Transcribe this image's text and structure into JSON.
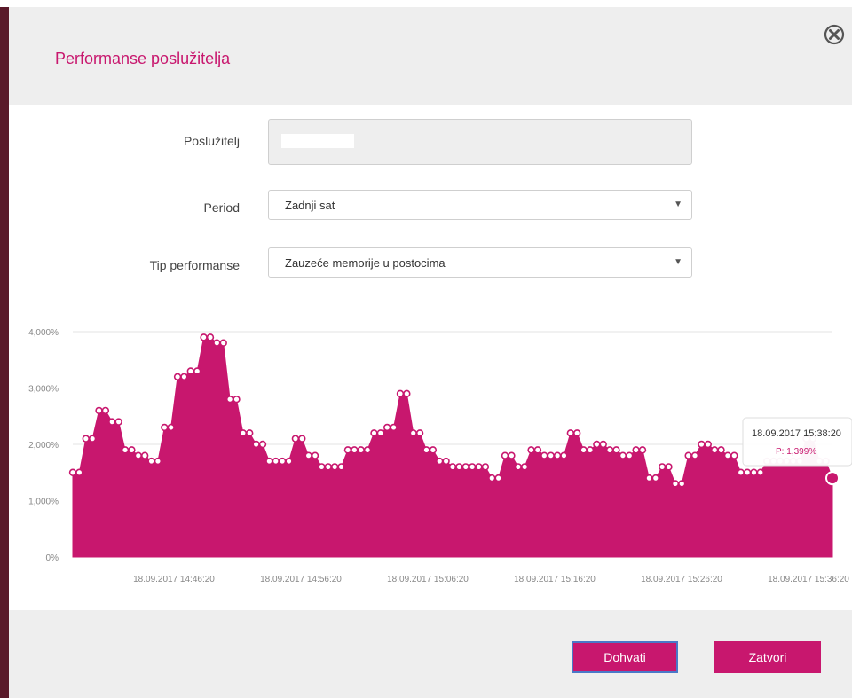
{
  "modal": {
    "title": "Performanse poslužitelja"
  },
  "form": {
    "server_label": "Poslužitelj",
    "server_value": "",
    "period_label": "Period",
    "period_value": "Zadnji sat",
    "type_label": "Tip performanse",
    "type_value": "Zauzeće memorije u postocima"
  },
  "footer": {
    "fetch_label": "Dohvati",
    "close_label": "Zatvori"
  },
  "icons": {
    "close": "close-circle-icon",
    "select_caret": "caret-down-icon"
  },
  "colors": {
    "accent": "#c8176e",
    "header_bg": "#eeeeee"
  },
  "chart_data": {
    "type": "area",
    "ytick_labels": [
      "0%",
      "1,000%",
      "2,000%",
      "3,000%",
      "4,000%"
    ],
    "ylim": [
      0,
      4
    ],
    "xtick_labels": [
      "18.09.2017 14:46:20",
      "18.09.2017 14:56:20",
      "18.09.2017 15:06:20",
      "18.09.2017 15:16:20",
      "18.09.2017 15:26:20",
      "18.09.2017 15:36:20"
    ],
    "series": [
      {
        "values": [
          1.5,
          1.5,
          2.1,
          2.1,
          2.6,
          2.6,
          2.4,
          2.4,
          1.9,
          1.9,
          1.8,
          1.8,
          1.7,
          1.7,
          2.3,
          2.3,
          3.2,
          3.2,
          3.3,
          3.3,
          3.9,
          3.9,
          3.8,
          3.8,
          2.8,
          2.8,
          2.2,
          2.2,
          2.0,
          2.0,
          1.7,
          1.7,
          1.7,
          1.7,
          2.1,
          2.1,
          1.8,
          1.8,
          1.6,
          1.6,
          1.6,
          1.6,
          1.9,
          1.9,
          1.9,
          1.9,
          2.2,
          2.2,
          2.3,
          2.3,
          2.9,
          2.9,
          2.2,
          2.2,
          1.9,
          1.9,
          1.7,
          1.7,
          1.6,
          1.6,
          1.6,
          1.6,
          1.6,
          1.6,
          1.4,
          1.4,
          1.8,
          1.8,
          1.6,
          1.6,
          1.9,
          1.9,
          1.8,
          1.8,
          1.8,
          1.8,
          2.2,
          2.2,
          1.9,
          1.9,
          2.0,
          2.0,
          1.9,
          1.9,
          1.8,
          1.8,
          1.9,
          1.9,
          1.4,
          1.4,
          1.6,
          1.6,
          1.3,
          1.3,
          1.8,
          1.8,
          2.0,
          2.0,
          1.9,
          1.9,
          1.8,
          1.8,
          1.5,
          1.5,
          1.5,
          1.5,
          1.7,
          1.7,
          1.7,
          1.7,
          1.7,
          1.7,
          2.1,
          2.1,
          1.7,
          1.7,
          1.399
        ]
      }
    ],
    "tooltip": {
      "title": "18.09.2017 15:38:20",
      "value": "P: 1,399%"
    },
    "grid": true,
    "color": "#c8176e"
  }
}
